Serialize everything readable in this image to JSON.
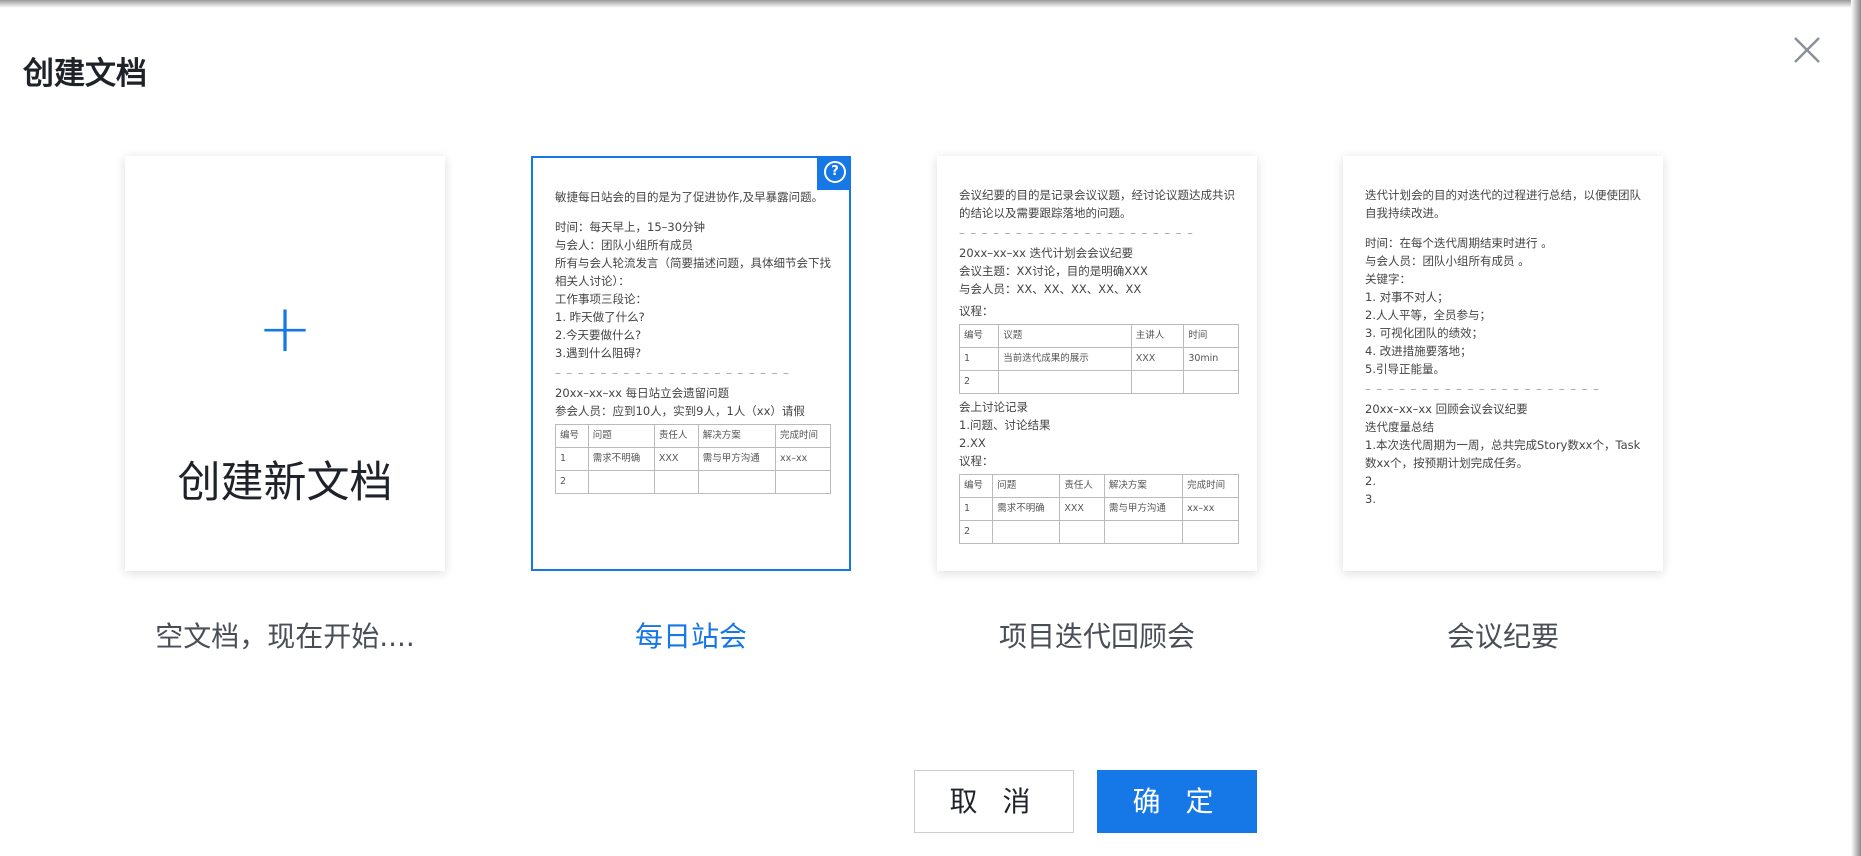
{
  "dialog": {
    "title": "创建文档",
    "close_icon": "close-icon"
  },
  "cards": [
    {
      "preview_title": "创建新文档",
      "caption": "空文档，现在开始....",
      "icon": "plus-icon"
    },
    {
      "caption": "每日站会",
      "help_icon": "question-circle-icon",
      "intro": "敏捷每日站会的目的是为了促进协作,及早暴露问题。",
      "body": "时间：每天早上，15–30分钟\n与会人：团队小组所有成员\n所有与会人轮流发言（简要描述问题，具体细节会下找相关人讨论）：\n工作事项三段论：\n1. 昨天做了什么?\n2.今天要做什么?\n3.遇到什么阻碍?",
      "dash": "– – – – – – – – – – – – – – – – – – – – –",
      "sub_title": "20xx–xx–xx 每日站立会遗留问题",
      "attendees": "参会人员：应到10人，实到9人，1人（xx）请假",
      "table": [
        [
          "编号",
          "问题",
          "责任人",
          "解决方案",
          "完成时间"
        ],
        [
          "1",
          "需求不明确",
          "XXX",
          "需与甲方沟通",
          "xx–xx"
        ],
        [
          "2",
          "",
          "",
          "",
          ""
        ]
      ]
    },
    {
      "caption": "项目迭代回顾会",
      "intro": "会议纪要的目的是记录会议议题，经讨论议题达成共识的结论以及需要跟踪落地的问题。",
      "dash": "– – – – – – – – – – – – – – – – – – – – –",
      "body": "20xx–xx–xx 迭代计划会会议纪要\n会议主题：XX讨论，目的是明确XXX\n与会人员：XX、XX、XX、XX、XX",
      "agenda_label": "议程：",
      "agenda_table": [
        [
          "编号",
          "议题",
          "主讲人",
          "时间"
        ],
        [
          "1",
          "当前迭代成果的展示",
          "XXX",
          "30min"
        ],
        [
          "2",
          "",
          "",
          ""
        ]
      ],
      "discussion": "会上讨论记录\n1.问题、讨论结果\n2.XX",
      "agenda_label2": "议程：",
      "issue_table": [
        [
          "编号",
          "问题",
          "责任人",
          "解决方案",
          "完成时间"
        ],
        [
          "1",
          "需求不明确",
          "XXX",
          "需与甲方沟通",
          "xx–xx"
        ],
        [
          "2",
          "",
          "",
          "",
          ""
        ]
      ]
    },
    {
      "caption": "会议纪要",
      "intro": "迭代计划会的目的对迭代的过程进行总结，以便使团队自我持续改进。",
      "body": "时间：在每个迭代周期结束时进行 。\n与会人员：团队小组所有成员 。\n关键字：\n1. 对事不对人；\n2.人人平等，全员参与；\n3. 可视化团队的绩效；\n4. 改进措施要落地；\n5.引导正能量。",
      "dash": "– – – – – – – – – – – – – – – – – – – – –",
      "body2": "20xx–xx–xx 回顾会议会议纪要\n迭代度量总结\n1.本次迭代周期为一周，总共完成Story数xx个，Task数xx个，按预期计划完成任务。\n2.\n3."
    }
  ],
  "footer": {
    "cancel": "取 消",
    "confirm": "确 定"
  }
}
